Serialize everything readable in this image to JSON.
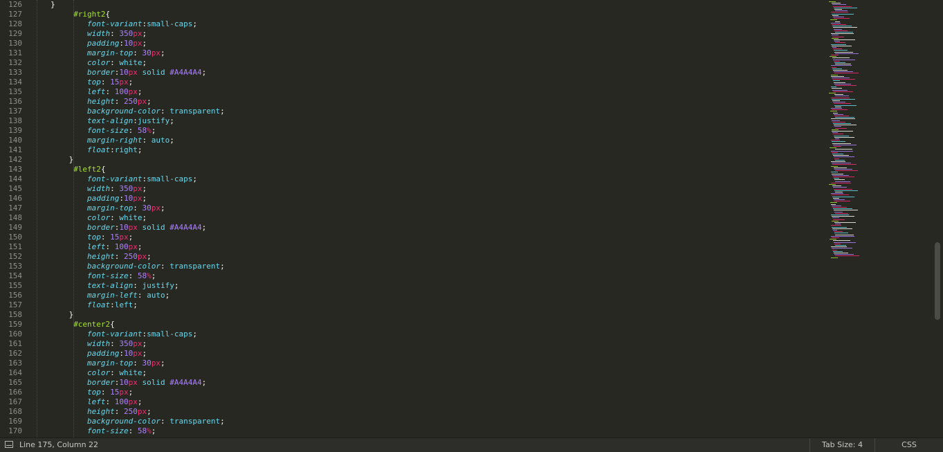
{
  "editor": {
    "lines": [
      {
        "n": "126",
        "indent": 5,
        "tokens": [
          {
            "t": "}",
            "c": "punc"
          }
        ]
      },
      {
        "n": "127",
        "indent": 10,
        "tokens": [
          {
            "t": "#right2",
            "c": "sel"
          },
          {
            "t": "{",
            "c": "punc"
          }
        ]
      },
      {
        "n": "128",
        "indent": 13,
        "tokens": [
          {
            "t": "font-variant",
            "c": "prop"
          },
          {
            "t": ":",
            "c": "punc"
          },
          {
            "t": "small-caps",
            "c": "val"
          },
          {
            "t": ";",
            "c": "punc"
          }
        ]
      },
      {
        "n": "129",
        "indent": 13,
        "tokens": [
          {
            "t": "width",
            "c": "prop"
          },
          {
            "t": ": ",
            "c": "punc"
          },
          {
            "t": "350",
            "c": "num"
          },
          {
            "t": "px",
            "c": "unit"
          },
          {
            "t": ";",
            "c": "punc"
          }
        ]
      },
      {
        "n": "130",
        "indent": 13,
        "tokens": [
          {
            "t": "padding",
            "c": "prop"
          },
          {
            "t": ":",
            "c": "punc"
          },
          {
            "t": "10",
            "c": "num"
          },
          {
            "t": "px",
            "c": "unit"
          },
          {
            "t": ";",
            "c": "punc"
          }
        ]
      },
      {
        "n": "131",
        "indent": 13,
        "tokens": [
          {
            "t": "margin-top",
            "c": "prop"
          },
          {
            "t": ": ",
            "c": "punc"
          },
          {
            "t": "30",
            "c": "num"
          },
          {
            "t": "px",
            "c": "unit"
          },
          {
            "t": ";",
            "c": "punc"
          }
        ]
      },
      {
        "n": "132",
        "indent": 13,
        "tokens": [
          {
            "t": "color",
            "c": "prop"
          },
          {
            "t": ": ",
            "c": "punc"
          },
          {
            "t": "white",
            "c": "val"
          },
          {
            "t": ";",
            "c": "punc"
          }
        ]
      },
      {
        "n": "133",
        "indent": 13,
        "tokens": [
          {
            "t": "border",
            "c": "prop"
          },
          {
            "t": ":",
            "c": "punc"
          },
          {
            "t": "10",
            "c": "num"
          },
          {
            "t": "px",
            "c": "unit"
          },
          {
            "t": " solid ",
            "c": "val"
          },
          {
            "t": "#A4A4A4",
            "c": "hex"
          },
          {
            "t": ";",
            "c": "punc"
          }
        ]
      },
      {
        "n": "134",
        "indent": 13,
        "tokens": [
          {
            "t": "top",
            "c": "prop"
          },
          {
            "t": ": ",
            "c": "punc"
          },
          {
            "t": "15",
            "c": "num"
          },
          {
            "t": "px",
            "c": "unit"
          },
          {
            "t": ";",
            "c": "punc"
          }
        ]
      },
      {
        "n": "135",
        "indent": 13,
        "tokens": [
          {
            "t": "left",
            "c": "prop"
          },
          {
            "t": ": ",
            "c": "punc"
          },
          {
            "t": "100",
            "c": "num"
          },
          {
            "t": "px",
            "c": "unit"
          },
          {
            "t": ";",
            "c": "punc"
          }
        ]
      },
      {
        "n": "136",
        "indent": 13,
        "tokens": [
          {
            "t": "height",
            "c": "prop"
          },
          {
            "t": ": ",
            "c": "punc"
          },
          {
            "t": "250",
            "c": "num"
          },
          {
            "t": "px",
            "c": "unit"
          },
          {
            "t": ";",
            "c": "punc"
          }
        ]
      },
      {
        "n": "137",
        "indent": 13,
        "tokens": [
          {
            "t": "background-color",
            "c": "prop"
          },
          {
            "t": ": ",
            "c": "punc"
          },
          {
            "t": "transparent",
            "c": "val"
          },
          {
            "t": ";",
            "c": "punc"
          }
        ]
      },
      {
        "n": "138",
        "indent": 13,
        "tokens": [
          {
            "t": "text-align",
            "c": "prop"
          },
          {
            "t": ":",
            "c": "punc"
          },
          {
            "t": "justify",
            "c": "val"
          },
          {
            "t": ";",
            "c": "punc"
          }
        ]
      },
      {
        "n": "139",
        "indent": 13,
        "tokens": [
          {
            "t": "font-size",
            "c": "prop"
          },
          {
            "t": ": ",
            "c": "punc"
          },
          {
            "t": "58",
            "c": "num"
          },
          {
            "t": "%",
            "c": "unit"
          },
          {
            "t": ";",
            "c": "punc"
          }
        ]
      },
      {
        "n": "140",
        "indent": 13,
        "tokens": [
          {
            "t": "margin-right",
            "c": "prop"
          },
          {
            "t": ": ",
            "c": "punc"
          },
          {
            "t": "auto",
            "c": "val"
          },
          {
            "t": ";",
            "c": "punc"
          }
        ]
      },
      {
        "n": "141",
        "indent": 13,
        "tokens": [
          {
            "t": "float",
            "c": "prop"
          },
          {
            "t": ":",
            "c": "punc"
          },
          {
            "t": "right",
            "c": "val"
          },
          {
            "t": ";",
            "c": "punc"
          }
        ]
      },
      {
        "n": "142",
        "indent": 9,
        "tokens": [
          {
            "t": "}",
            "c": "punc"
          }
        ]
      },
      {
        "n": "143",
        "indent": 10,
        "tokens": [
          {
            "t": "#left2",
            "c": "sel"
          },
          {
            "t": "{",
            "c": "punc"
          }
        ]
      },
      {
        "n": "144",
        "indent": 13,
        "tokens": [
          {
            "t": "font-variant",
            "c": "prop"
          },
          {
            "t": ":",
            "c": "punc"
          },
          {
            "t": "small-caps",
            "c": "val"
          },
          {
            "t": ";",
            "c": "punc"
          }
        ]
      },
      {
        "n": "145",
        "indent": 13,
        "tokens": [
          {
            "t": "width",
            "c": "prop"
          },
          {
            "t": ": ",
            "c": "punc"
          },
          {
            "t": "350",
            "c": "num"
          },
          {
            "t": "px",
            "c": "unit"
          },
          {
            "t": ";",
            "c": "punc"
          }
        ]
      },
      {
        "n": "146",
        "indent": 13,
        "tokens": [
          {
            "t": "padding",
            "c": "prop"
          },
          {
            "t": ":",
            "c": "punc"
          },
          {
            "t": "10",
            "c": "num"
          },
          {
            "t": "px",
            "c": "unit"
          },
          {
            "t": ";",
            "c": "punc"
          }
        ]
      },
      {
        "n": "147",
        "indent": 13,
        "tokens": [
          {
            "t": "margin-top",
            "c": "prop"
          },
          {
            "t": ": ",
            "c": "punc"
          },
          {
            "t": "30",
            "c": "num"
          },
          {
            "t": "px",
            "c": "unit"
          },
          {
            "t": ";",
            "c": "punc"
          }
        ]
      },
      {
        "n": "148",
        "indent": 13,
        "tokens": [
          {
            "t": "color",
            "c": "prop"
          },
          {
            "t": ": ",
            "c": "punc"
          },
          {
            "t": "white",
            "c": "val"
          },
          {
            "t": ";",
            "c": "punc"
          }
        ]
      },
      {
        "n": "149",
        "indent": 13,
        "tokens": [
          {
            "t": "border",
            "c": "prop"
          },
          {
            "t": ":",
            "c": "punc"
          },
          {
            "t": "10",
            "c": "num"
          },
          {
            "t": "px",
            "c": "unit"
          },
          {
            "t": " solid ",
            "c": "val"
          },
          {
            "t": "#A4A4A4",
            "c": "hex"
          },
          {
            "t": ";",
            "c": "punc"
          }
        ]
      },
      {
        "n": "150",
        "indent": 13,
        "tokens": [
          {
            "t": "top",
            "c": "prop"
          },
          {
            "t": ": ",
            "c": "punc"
          },
          {
            "t": "15",
            "c": "num"
          },
          {
            "t": "px",
            "c": "unit"
          },
          {
            "t": ";",
            "c": "punc"
          }
        ]
      },
      {
        "n": "151",
        "indent": 13,
        "tokens": [
          {
            "t": "left",
            "c": "prop"
          },
          {
            "t": ": ",
            "c": "punc"
          },
          {
            "t": "100",
            "c": "num"
          },
          {
            "t": "px",
            "c": "unit"
          },
          {
            "t": ";",
            "c": "punc"
          }
        ]
      },
      {
        "n": "152",
        "indent": 13,
        "tokens": [
          {
            "t": "height",
            "c": "prop"
          },
          {
            "t": ": ",
            "c": "punc"
          },
          {
            "t": "250",
            "c": "num"
          },
          {
            "t": "px",
            "c": "unit"
          },
          {
            "t": ";",
            "c": "punc"
          }
        ]
      },
      {
        "n": "153",
        "indent": 13,
        "tokens": [
          {
            "t": "background-color",
            "c": "prop"
          },
          {
            "t": ": ",
            "c": "punc"
          },
          {
            "t": "transparent",
            "c": "val"
          },
          {
            "t": ";",
            "c": "punc"
          }
        ]
      },
      {
        "n": "154",
        "indent": 13,
        "tokens": [
          {
            "t": "font-size",
            "c": "prop"
          },
          {
            "t": ": ",
            "c": "punc"
          },
          {
            "t": "58",
            "c": "num"
          },
          {
            "t": "%",
            "c": "unit"
          },
          {
            "t": ";",
            "c": "punc"
          }
        ]
      },
      {
        "n": "155",
        "indent": 13,
        "tokens": [
          {
            "t": "text-align",
            "c": "prop"
          },
          {
            "t": ": ",
            "c": "punc"
          },
          {
            "t": "justify",
            "c": "val"
          },
          {
            "t": ";",
            "c": "punc"
          }
        ]
      },
      {
        "n": "156",
        "indent": 13,
        "tokens": [
          {
            "t": "margin-left",
            "c": "prop"
          },
          {
            "t": ": ",
            "c": "punc"
          },
          {
            "t": "auto",
            "c": "val"
          },
          {
            "t": ";",
            "c": "punc"
          }
        ]
      },
      {
        "n": "157",
        "indent": 13,
        "tokens": [
          {
            "t": "float",
            "c": "prop"
          },
          {
            "t": ":",
            "c": "punc"
          },
          {
            "t": "left",
            "c": "val"
          },
          {
            "t": ";",
            "c": "punc"
          }
        ]
      },
      {
        "n": "158",
        "indent": 9,
        "tokens": [
          {
            "t": "}",
            "c": "punc"
          }
        ]
      },
      {
        "n": "159",
        "indent": 10,
        "tokens": [
          {
            "t": "#center2",
            "c": "sel"
          },
          {
            "t": "{",
            "c": "punc"
          }
        ]
      },
      {
        "n": "160",
        "indent": 13,
        "tokens": [
          {
            "t": "font-variant",
            "c": "prop"
          },
          {
            "t": ":",
            "c": "punc"
          },
          {
            "t": "small-caps",
            "c": "val"
          },
          {
            "t": ";",
            "c": "punc"
          }
        ]
      },
      {
        "n": "161",
        "indent": 13,
        "tokens": [
          {
            "t": "width",
            "c": "prop"
          },
          {
            "t": ": ",
            "c": "punc"
          },
          {
            "t": "350",
            "c": "num"
          },
          {
            "t": "px",
            "c": "unit"
          },
          {
            "t": ";",
            "c": "punc"
          }
        ]
      },
      {
        "n": "162",
        "indent": 13,
        "tokens": [
          {
            "t": "padding",
            "c": "prop"
          },
          {
            "t": ":",
            "c": "punc"
          },
          {
            "t": "10",
            "c": "num"
          },
          {
            "t": "px",
            "c": "unit"
          },
          {
            "t": ";",
            "c": "punc"
          }
        ]
      },
      {
        "n": "163",
        "indent": 13,
        "tokens": [
          {
            "t": "margin-top",
            "c": "prop"
          },
          {
            "t": ": ",
            "c": "punc"
          },
          {
            "t": "30",
            "c": "num"
          },
          {
            "t": "px",
            "c": "unit"
          },
          {
            "t": ";",
            "c": "punc"
          }
        ]
      },
      {
        "n": "164",
        "indent": 13,
        "tokens": [
          {
            "t": "color",
            "c": "prop"
          },
          {
            "t": ": ",
            "c": "punc"
          },
          {
            "t": "white",
            "c": "val"
          },
          {
            "t": ";",
            "c": "punc"
          }
        ]
      },
      {
        "n": "165",
        "indent": 13,
        "tokens": [
          {
            "t": "border",
            "c": "prop"
          },
          {
            "t": ":",
            "c": "punc"
          },
          {
            "t": "10",
            "c": "num"
          },
          {
            "t": "px",
            "c": "unit"
          },
          {
            "t": " solid ",
            "c": "val"
          },
          {
            "t": "#A4A4A4",
            "c": "hex"
          },
          {
            "t": ";",
            "c": "punc"
          }
        ]
      },
      {
        "n": "166",
        "indent": 13,
        "tokens": [
          {
            "t": "top",
            "c": "prop"
          },
          {
            "t": ": ",
            "c": "punc"
          },
          {
            "t": "15",
            "c": "num"
          },
          {
            "t": "px",
            "c": "unit"
          },
          {
            "t": ";",
            "c": "punc"
          }
        ]
      },
      {
        "n": "167",
        "indent": 13,
        "tokens": [
          {
            "t": "left",
            "c": "prop"
          },
          {
            "t": ": ",
            "c": "punc"
          },
          {
            "t": "100",
            "c": "num"
          },
          {
            "t": "px",
            "c": "unit"
          },
          {
            "t": ";",
            "c": "punc"
          }
        ]
      },
      {
        "n": "168",
        "indent": 13,
        "tokens": [
          {
            "t": "height",
            "c": "prop"
          },
          {
            "t": ": ",
            "c": "punc"
          },
          {
            "t": "250",
            "c": "num"
          },
          {
            "t": "px",
            "c": "unit"
          },
          {
            "t": ";",
            "c": "punc"
          }
        ]
      },
      {
        "n": "169",
        "indent": 13,
        "tokens": [
          {
            "t": "background-color",
            "c": "prop"
          },
          {
            "t": ": ",
            "c": "punc"
          },
          {
            "t": "transparent",
            "c": "val"
          },
          {
            "t": ";",
            "c": "punc"
          }
        ]
      },
      {
        "n": "170",
        "indent": 13,
        "tokens": [
          {
            "t": "font-size",
            "c": "prop"
          },
          {
            "t": ": ",
            "c": "punc"
          },
          {
            "t": "58",
            "c": "num"
          },
          {
            "t": "%",
            "c": "unit"
          },
          {
            "t": ";",
            "c": "punc"
          }
        ]
      }
    ]
  },
  "status": {
    "position": "Line 175, Column 22",
    "tab_size": "Tab Size: 4",
    "syntax": "CSS",
    "panel_icon": "panel-toggle-icon"
  },
  "theme": {
    "background": "#272822",
    "selector": "#A6E22E",
    "property": "#66D9EF",
    "number": "#AE81FF",
    "unit": "#F92672",
    "text": "#F8F8F2",
    "gutter_text": "#8F908A"
  }
}
